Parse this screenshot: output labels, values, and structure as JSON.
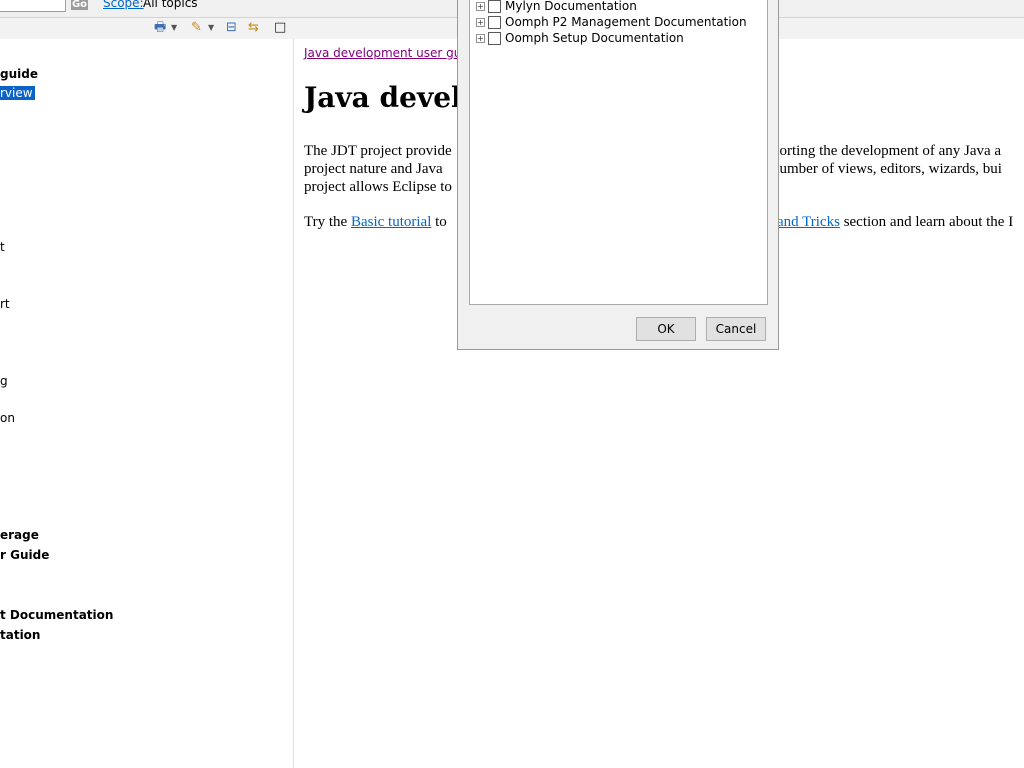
{
  "search": {
    "value": "",
    "go_label": "Go",
    "scope_link": "Scope:",
    "scope_value": "All topics"
  },
  "toolbar": {
    "icons": [
      "printable-icon",
      "highlight-search-icon",
      "collapse-icon"
    ]
  },
  "toc": {
    "items": [
      {
        "label": "guide",
        "bold": true
      },
      {
        "label": "rview",
        "selected": true
      },
      {
        "label": "t"
      },
      {
        "label": "rt"
      },
      {
        "label": "g"
      },
      {
        "label": "on"
      },
      {
        "label": "erage",
        "bold": true
      },
      {
        "label": "r Guide",
        "bold": true
      },
      {
        "label": "t Documentation",
        "bold": true
      },
      {
        "label": "tation",
        "bold": true
      }
    ]
  },
  "content": {
    "breadcrumb": "Java development user guide",
    "title": "Java develo",
    "para1": {
      "line1_a": "The JDT project provide",
      "line1_b": "porting the development of any Java a",
      "line2_a": "project nature and Java",
      "line2_b": "number of views, editors, wizards, bui",
      "line3_a": "project allows Eclipse to"
    },
    "para2": {
      "prefix": "Try the ",
      "link1": "Basic tutorial",
      "middle": " to",
      "link2": "and Tricks",
      "suffix": " section and learn about the I"
    }
  },
  "dialog": {
    "tree_items": [
      {
        "label": "Mylyn Documentation",
        "checked": false
      },
      {
        "label": "Oomph P2 Management Documentation",
        "checked": false
      },
      {
        "label": "Oomph Setup Documentation",
        "checked": false
      }
    ],
    "ok_label": "OK",
    "cancel_label": "Cancel"
  }
}
